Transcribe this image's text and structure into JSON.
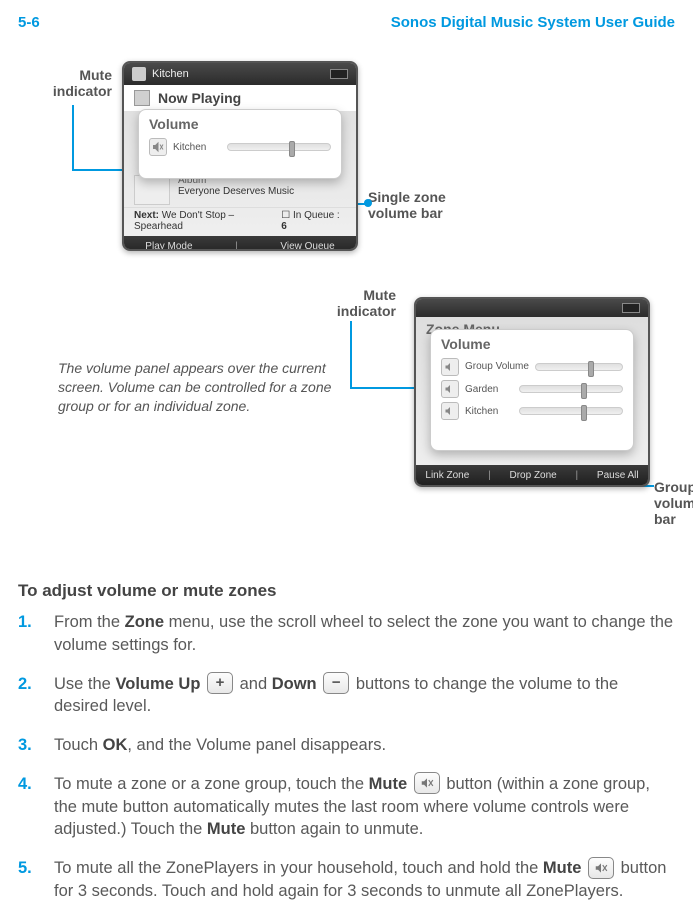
{
  "header": {
    "page_number": "5-6",
    "guide_title": "Sonos Digital Music System User Guide"
  },
  "callouts": {
    "mute1": "Mute indicator",
    "single_bar": "Single zone volume bar",
    "mute2": "Mute indicator",
    "group_bar": "Group volume bar",
    "note": "The volume panel appears over the current screen. Volume can be controlled for a zone group or for an individual zone."
  },
  "screenshot1": {
    "zone_name": "Kitchen",
    "now_playing": "Now Playing",
    "popup_title": "Volume",
    "row_label": "Kitchen",
    "album_label": "Album",
    "album_value": "Everyone Deserves Music",
    "next_label": "Next:",
    "next_value": "We Don't Stop – Spearhead",
    "queue_label": "In Queue :",
    "queue_value": "6",
    "bottom_left": "Play Mode",
    "bottom_right": "View Queue"
  },
  "screenshot2": {
    "menu_title": "Zone Menu",
    "popup_title": "Volume",
    "rows": [
      {
        "label": "Group Volume"
      },
      {
        "label": "Garden"
      },
      {
        "label": "Kitchen"
      }
    ],
    "bottom": [
      "Link Zone",
      "Drop Zone",
      "Pause All"
    ]
  },
  "section_title": "To adjust volume or mute zones",
  "steps": {
    "s1": {
      "num": "1.",
      "pre": "From the ",
      "b1": "Zone",
      "post": " menu, use the scroll wheel to select the zone you want to change the volume settings for."
    },
    "s2": {
      "num": "2.",
      "t1": "Use the ",
      "b1": "Volume Up",
      "t2": " and ",
      "b2": "Down",
      "t3": " buttons to change the volume to the desired level."
    },
    "s3": {
      "num": "3.",
      "t1": "Touch ",
      "b1": "OK",
      "t2": ", and the Volume panel disappears."
    },
    "s4": {
      "num": "4.",
      "t1": "To mute a zone or a zone group, touch the ",
      "b1": "Mute",
      "t2": " button (within a zone group, the mute button automatically mutes the last room where volume controls were adjusted.) Touch the ",
      "b2": "Mute",
      "t3": " button again to unmute."
    },
    "s5": {
      "num": "5.",
      "t1": "To mute all the ZonePlayers in your household, touch and hold the ",
      "b1": "Mute",
      "t2": " button for 3 seconds. Touch and hold again for 3 seconds to unmute all ZonePlayers."
    }
  },
  "icons": {
    "plus": "+",
    "minus": "−"
  }
}
